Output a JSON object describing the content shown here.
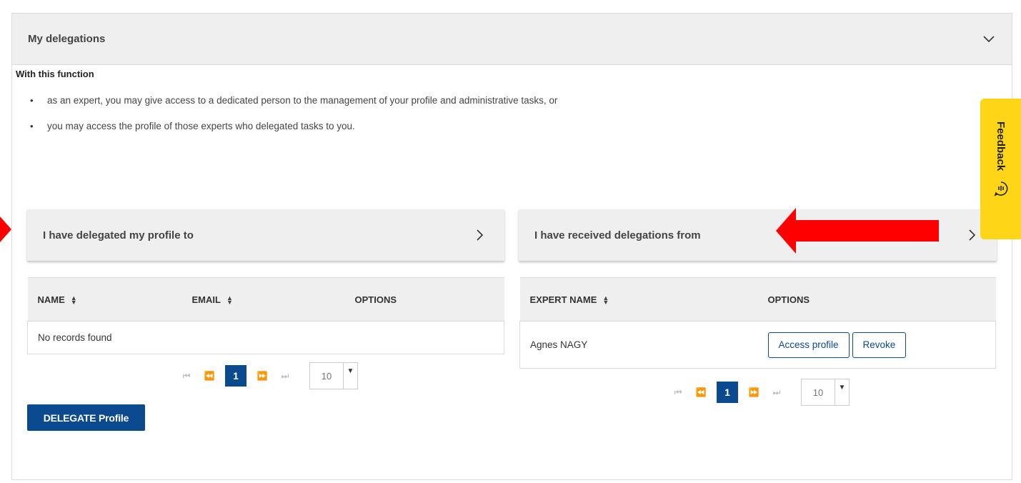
{
  "panel": {
    "title": "My delegations"
  },
  "intro": {
    "heading": "With this function",
    "bullets": [
      "as an expert, you may give access to a dedicated person to the management of your profile and administrative tasks, or",
      "you may access the profile of those experts who delegated tasks to you."
    ]
  },
  "delegated": {
    "title": "I have delegated my profile to",
    "columns": [
      "NAME",
      "EMAIL",
      "OPTIONS"
    ],
    "empty_text": "No records found",
    "pager": {
      "page": "1",
      "page_size": "10"
    },
    "delegate_button": "DELEGATE Profile"
  },
  "received": {
    "title": "I have received delegations from",
    "columns": [
      "EXPERT NAME",
      "OPTIONS"
    ],
    "rows": [
      {
        "expert_name": "Agnes NAGY",
        "access_label": "Access profile",
        "revoke_label": "Revoke"
      }
    ],
    "pager": {
      "page": "1",
      "page_size": "10"
    }
  },
  "feedback": {
    "label": "Feedback"
  },
  "colors": {
    "primary": "#0b4a8f",
    "feedback": "#ffd617",
    "annotation_arrow": "#ff0000",
    "header_bg": "#efefef"
  }
}
